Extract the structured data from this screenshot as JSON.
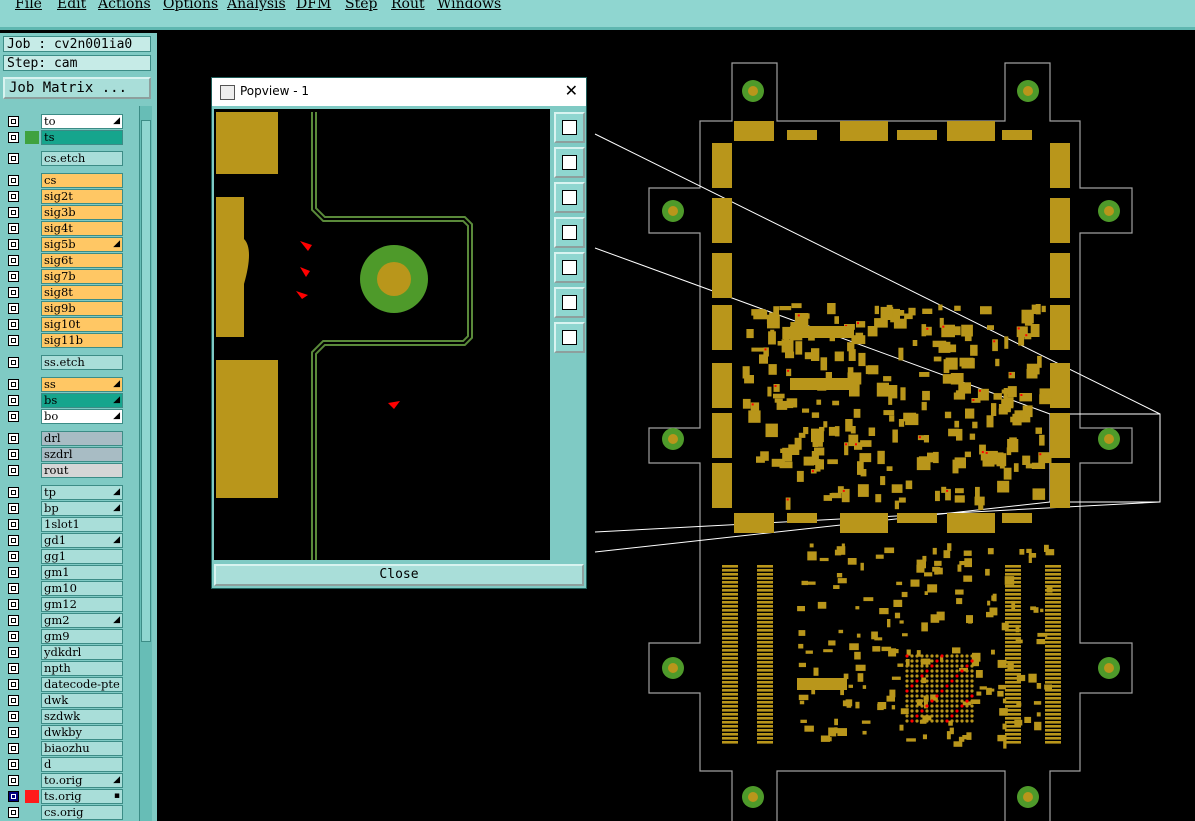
{
  "menu": [
    "File",
    "Edit",
    "Actions",
    "Options",
    "Analysis",
    "DFM",
    "Step",
    "Rout",
    "Windows"
  ],
  "job_label": "Job : cv2n001ia0",
  "step_label": "Step: cam",
  "job_matrix_label": "Job Matrix ...",
  "layers": [
    {
      "name": "to",
      "color": "#ffffff",
      "mark": "",
      "flag": "◢"
    },
    {
      "name": "ts",
      "color": "#16a58d",
      "mark": "#3fa23f",
      "flag": ""
    },
    {
      "name": "cs.etch",
      "color": "#a9ded9",
      "mark": "",
      "flag": ""
    },
    {
      "name": "cs",
      "color": "#ffc764",
      "mark": "",
      "flag": ""
    },
    {
      "name": "sig2t",
      "color": "#ffc764",
      "mark": "",
      "flag": ""
    },
    {
      "name": "sig3b",
      "color": "#ffc764",
      "mark": "",
      "flag": ""
    },
    {
      "name": "sig4t",
      "color": "#ffc764",
      "mark": "",
      "flag": ""
    },
    {
      "name": "sig5b",
      "color": "#ffc764",
      "mark": "",
      "flag": "◢"
    },
    {
      "name": "sig6t",
      "color": "#ffc764",
      "mark": "",
      "flag": ""
    },
    {
      "name": "sig7b",
      "color": "#ffc764",
      "mark": "",
      "flag": ""
    },
    {
      "name": "sig8t",
      "color": "#ffc764",
      "mark": "",
      "flag": ""
    },
    {
      "name": "sig9b",
      "color": "#ffc764",
      "mark": "",
      "flag": ""
    },
    {
      "name": "sig10t",
      "color": "#ffc764",
      "mark": "",
      "flag": ""
    },
    {
      "name": "sig11b",
      "color": "#ffc764",
      "mark": "",
      "flag": ""
    },
    {
      "name": "ss.etch",
      "color": "#a9ded9",
      "mark": "",
      "flag": ""
    },
    {
      "name": "ss",
      "color": "#ffc764",
      "mark": "",
      "flag": "◢"
    },
    {
      "name": "bs",
      "color": "#16a58d",
      "mark": "",
      "flag": "◢"
    },
    {
      "name": "bo",
      "color": "#ffffff",
      "mark": "",
      "flag": "◢"
    },
    {
      "name": "drl",
      "color": "#a8bcc4",
      "mark": "",
      "flag": ""
    },
    {
      "name": "szdrl",
      "color": "#a8bcc4",
      "mark": "",
      "flag": ""
    },
    {
      "name": "rout",
      "color": "#d6d6d6",
      "mark": "",
      "flag": ""
    },
    {
      "name": "tp",
      "color": "#a9ded9",
      "mark": "",
      "flag": "◢"
    },
    {
      "name": "bp",
      "color": "#a9ded9",
      "mark": "",
      "flag": "◢"
    },
    {
      "name": "1slot1",
      "color": "#a9ded9",
      "mark": "",
      "flag": ""
    },
    {
      "name": "gd1",
      "color": "#a9ded9",
      "mark": "",
      "flag": "◢"
    },
    {
      "name": "gg1",
      "color": "#a9ded9",
      "mark": "",
      "flag": ""
    },
    {
      "name": "gm1",
      "color": "#a9ded9",
      "mark": "",
      "flag": ""
    },
    {
      "name": "gm10",
      "color": "#a9ded9",
      "mark": "",
      "flag": ""
    },
    {
      "name": "gm12",
      "color": "#a9ded9",
      "mark": "",
      "flag": ""
    },
    {
      "name": "gm2",
      "color": "#a9ded9",
      "mark": "",
      "flag": "◢"
    },
    {
      "name": "gm9",
      "color": "#a9ded9",
      "mark": "",
      "flag": ""
    },
    {
      "name": "ydkdrl",
      "color": "#a9ded9",
      "mark": "",
      "flag": ""
    },
    {
      "name": "npth",
      "color": "#a9ded9",
      "mark": "",
      "flag": ""
    },
    {
      "name": "datecode-pte",
      "color": "#a9ded9",
      "mark": "",
      "flag": ""
    },
    {
      "name": "dwk",
      "color": "#a9ded9",
      "mark": "",
      "flag": ""
    },
    {
      "name": "szdwk",
      "color": "#a9ded9",
      "mark": "",
      "flag": ""
    },
    {
      "name": "dwkby",
      "color": "#a9ded9",
      "mark": "",
      "flag": ""
    },
    {
      "name": "biaozhu",
      "color": "#a9ded9",
      "mark": "",
      "flag": ""
    },
    {
      "name": "d",
      "color": "#a9ded9",
      "mark": "",
      "flag": ""
    },
    {
      "name": "to.orig",
      "color": "#a9ded9",
      "mark": "",
      "flag": "◢"
    },
    {
      "name": "ts.orig",
      "color": "#a9ded9",
      "mark": "#ff1a1a",
      "flag": "▪",
      "selected": true
    },
    {
      "name": "cs.orig",
      "color": "#a9ded9",
      "mark": "",
      "flag": ""
    }
  ],
  "popup": {
    "title": "Popview - 1",
    "close_x": "✕",
    "close_label": "Close",
    "tools": [
      "zoom-fit-icon",
      "layer-up-icon",
      "layer-down-icon",
      "pan-left-icon",
      "pan-right-icon",
      "zoom-in-icon",
      "zoom-out-icon"
    ]
  },
  "colors": {
    "copper": "#b9961b",
    "mask": "#4e9a2a",
    "panel": "#7fcac4",
    "trace": "#5a8a3a",
    "highlight": "#ff0000"
  }
}
